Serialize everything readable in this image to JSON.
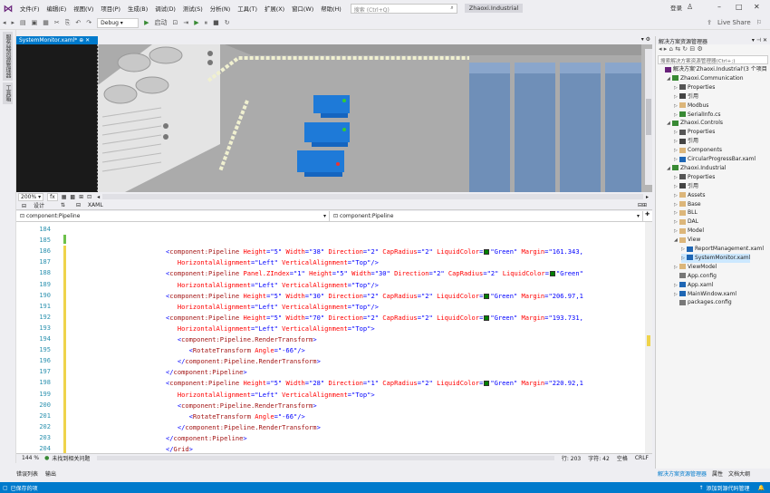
{
  "menubar": {
    "items": [
      "文件(F)",
      "编辑(E)",
      "视图(V)",
      "项目(P)",
      "生成(B)",
      "调试(D)",
      "测试(S)",
      "分析(N)",
      "工具(T)",
      "扩展(X)",
      "窗口(W)",
      "帮助(H)"
    ],
    "search_placeholder": "搜索 (Ctrl+Q)",
    "solution_name": "Zhaoxi.Industrial",
    "login": "登录",
    "live_share": "Live Share"
  },
  "toolbar": {
    "config": "Debug",
    "start_label": "启动"
  },
  "left_strip": [
    "服务器资源管理器",
    "工具箱"
  ],
  "doc_tab": {
    "label": "SystemMonitor.xaml*"
  },
  "designer_bar": {
    "zoom": "200%",
    "fx": "fx"
  },
  "split_bar": {
    "design": "设计",
    "swap": "⇅",
    "xaml": "XAML"
  },
  "nav_bar": {
    "left": "component:Pipeline",
    "right": "component:Pipeline"
  },
  "colors": {
    "accent": "#007acc",
    "tag": "#a31515",
    "attr": "#ff0000",
    "value": "#0000ff",
    "linenum": "#2b91af",
    "green": "#008000"
  },
  "code": [
    {
      "n": "184",
      "html": ""
    },
    {
      "n": "185",
      "html": ""
    },
    {
      "n": "186",
      "html": "<span class=\"br\">&lt;</span><span class=\"tagc\">component:Pipeline</span> <span class=\"attr\">Height</span><span class=\"br\">=</span><span class=\"val\">\"5\"</span> <span class=\"attr\">Width</span><span class=\"br\">=</span><span class=\"val\">\"38\"</span> <span class=\"attr\">Direction</span><span class=\"br\">=</span><span class=\"val\">\"2\"</span> <span class=\"attr\">CapRadius</span><span class=\"br\">=</span><span class=\"val\">\"2\"</span> <span class=\"attr\">LiquidColor</span><span class=\"br\">=</span><span class=\"sw\" style=\"background:#008000\"></span><span class=\"val\">\"Green\"</span> <span class=\"attr\">Margin</span><span class=\"br\">=</span><span class=\"val\">\"161.343,</span>"
    },
    {
      "n": "187",
      "html": "&nbsp;&nbsp;&nbsp;<span class=\"attr\">HorizontalAlignment</span><span class=\"br\">=</span><span class=\"val\">\"Left\"</span> <span class=\"attr\">VerticalAlignment</span><span class=\"br\">=</span><span class=\"val\">\"Top\"</span><span class=\"br\">/&gt;</span>"
    },
    {
      "n": "188",
      "html": "<span class=\"br\">&lt;</span><span class=\"tagc\">component:Pipeline</span> <span class=\"attr\">Panel.ZIndex</span><span class=\"br\">=</span><span class=\"val\">\"1\"</span> <span class=\"attr\">Height</span><span class=\"br\">=</span><span class=\"val\">\"5\"</span> <span class=\"attr\">Width</span><span class=\"br\">=</span><span class=\"val\">\"30\"</span> <span class=\"attr\">Direction</span><span class=\"br\">=</span><span class=\"val\">\"2\"</span> <span class=\"attr\">CapRadius</span><span class=\"br\">=</span><span class=\"val\">\"2\"</span> <span class=\"attr\">LiquidColor</span><span class=\"br\">=</span><span class=\"sw\" style=\"background:#008000\"></span><span class=\"val\">\"Green\"</span>"
    },
    {
      "n": "189",
      "html": "&nbsp;&nbsp;&nbsp;<span class=\"attr\">HorizontalAlignment</span><span class=\"br\">=</span><span class=\"val\">\"Left\"</span> <span class=\"attr\">VerticalAlignment</span><span class=\"br\">=</span><span class=\"val\">\"Top\"</span><span class=\"br\">/&gt;</span>"
    },
    {
      "n": "190",
      "html": "<span class=\"br\">&lt;</span><span class=\"tagc\">component:Pipeline</span> <span class=\"attr\">Height</span><span class=\"br\">=</span><span class=\"val\">\"5\"</span> <span class=\"attr\">Width</span><span class=\"br\">=</span><span class=\"val\">\"30\"</span> <span class=\"attr\">Direction</span><span class=\"br\">=</span><span class=\"val\">\"2\"</span> <span class=\"attr\">CapRadius</span><span class=\"br\">=</span><span class=\"val\">\"2\"</span> <span class=\"attr\">LiquidColor</span><span class=\"br\">=</span><span class=\"sw\" style=\"background:#008000\"></span><span class=\"val\">\"Green\"</span> <span class=\"attr\">Margin</span><span class=\"br\">=</span><span class=\"val\">\"206.97,1</span>"
    },
    {
      "n": "191",
      "html": "&nbsp;&nbsp;&nbsp;<span class=\"attr\">HorizontalAlignment</span><span class=\"br\">=</span><span class=\"val\">\"Left\"</span> <span class=\"attr\">VerticalAlignment</span><span class=\"br\">=</span><span class=\"val\">\"Top\"</span><span class=\"br\">/&gt;</span>"
    },
    {
      "n": "192",
      "html": "<span class=\"br\">&lt;</span><span class=\"tagc\">component:Pipeline</span> <span class=\"attr\">Height</span><span class=\"br\">=</span><span class=\"val\">\"5\"</span> <span class=\"attr\">Width</span><span class=\"br\">=</span><span class=\"val\">\"70\"</span> <span class=\"attr\">Direction</span><span class=\"br\">=</span><span class=\"val\">\"2\"</span> <span class=\"attr\">CapRadius</span><span class=\"br\">=</span><span class=\"val\">\"2\"</span> <span class=\"attr\">LiquidColor</span><span class=\"br\">=</span><span class=\"sw\" style=\"background:#008000\"></span><span class=\"val\">\"Green\"</span> <span class=\"attr\">Margin</span><span class=\"br\">=</span><span class=\"val\">\"193.731,</span>"
    },
    {
      "n": "193",
      "html": "&nbsp;&nbsp;&nbsp;<span class=\"attr\">HorizontalAlignment</span><span class=\"br\">=</span><span class=\"val\">\"Left\"</span> <span class=\"attr\">VerticalAlignment</span><span class=\"br\">=</span><span class=\"val\">\"Top\"</span><span class=\"br\">&gt;</span>"
    },
    {
      "n": "194",
      "html": "&nbsp;&nbsp;&nbsp;<span class=\"br\">&lt;</span><span class=\"tagc\">component:Pipeline.RenderTransform</span><span class=\"br\">&gt;</span>"
    },
    {
      "n": "195",
      "html": "&nbsp;&nbsp;&nbsp;&nbsp;&nbsp;&nbsp;<span class=\"br\">&lt;</span><span class=\"tagc\">RotateTransform</span> <span class=\"attr\">Angle</span><span class=\"br\">=</span><span class=\"val\">\"-66\"</span><span class=\"br\">/&gt;</span>"
    },
    {
      "n": "196",
      "html": "&nbsp;&nbsp;&nbsp;<span class=\"br\">&lt;/</span><span class=\"tagc\">component:Pipeline.RenderTransform</span><span class=\"br\">&gt;</span>"
    },
    {
      "n": "197",
      "html": "<span class=\"br\">&lt;/</span><span class=\"tagc\">component:Pipeline</span><span class=\"br\">&gt;</span>"
    },
    {
      "n": "198",
      "html": "<span class=\"br\">&lt;</span><span class=\"tagc\">component:Pipeline</span> <span class=\"attr\">Height</span><span class=\"br\">=</span><span class=\"val\">\"5\"</span> <span class=\"attr\">Width</span><span class=\"br\">=</span><span class=\"val\">\"28\"</span> <span class=\"attr\">Direction</span><span class=\"br\">=</span><span class=\"val\">\"1\"</span> <span class=\"attr\">CapRadius</span><span class=\"br\">=</span><span class=\"val\">\"2\"</span> <span class=\"attr\">LiquidColor</span><span class=\"br\">=</span><span class=\"sw\" style=\"background:#008000\"></span><span class=\"val\">\"Green\"</span> <span class=\"attr\">Margin</span><span class=\"br\">=</span><span class=\"val\">\"220.92,1</span>"
    },
    {
      "n": "199",
      "html": "&nbsp;&nbsp;&nbsp;<span class=\"attr\">HorizontalAlignment</span><span class=\"br\">=</span><span class=\"val\">\"Left\"</span> <span class=\"attr\">VerticalAlignment</span><span class=\"br\">=</span><span class=\"val\">\"Top\"</span><span class=\"br\">&gt;</span>"
    },
    {
      "n": "200",
      "html": "&nbsp;&nbsp;&nbsp;<span class=\"br\">&lt;</span><span class=\"tagc\">component:Pipeline.RenderTransform</span><span class=\"br\">&gt;</span>"
    },
    {
      "n": "201",
      "html": "&nbsp;&nbsp;&nbsp;&nbsp;&nbsp;&nbsp;<span class=\"br\">&lt;</span><span class=\"tagc\">RotateTransform</span> <span class=\"attr\">Angle</span><span class=\"br\">=</span><span class=\"val\">\"-66\"</span><span class=\"br\">/&gt;</span>"
    },
    {
      "n": "202",
      "html": "&nbsp;&nbsp;&nbsp;<span class=\"br\">&lt;/</span><span class=\"tagc\">component:Pipeline.RenderTransform</span><span class=\"br\">&gt;</span>"
    },
    {
      "n": "203",
      "html": "<span class=\"br\">&lt;/</span><span class=\"tagc\">component:Pipeline</span><span class=\"br\">&gt;</span>"
    },
    {
      "n": "204",
      "html": "<span class=\"br\">&lt;/</span><span class=\"tagc\">Grid</span><span class=\"br\">&gt;</span>"
    }
  ],
  "status": {
    "zoom": "144 %",
    "issues": "未找到相关问题",
    "line": "行: 203",
    "col": "字符: 42",
    "mode1": "空格",
    "mode2": "CRLF"
  },
  "bottom_tabs": [
    "错误列表",
    "输出"
  ],
  "vs_status": {
    "left": "已保存的项",
    "right": "添加到源代码管理"
  },
  "solution_explorer": {
    "title": "解决方案资源管理器",
    "search": "搜索解决方案资源管理器(Ctrl+;)",
    "items": [
      {
        "label": "解决方案'Zhaoxi.Industrial'(3 个项目",
        "icon": "solution-icon"
      },
      {
        "label": "Zhaoxi.Communication",
        "icon": "csproj-icon"
      },
      {
        "label": "Properties",
        "icon": "wrench-icon"
      },
      {
        "label": "引用",
        "icon": "ref-icon"
      },
      {
        "label": "Modbus",
        "icon": "folder-icon"
      },
      {
        "label": "SerialInfo.cs",
        "icon": "cs-icon"
      },
      {
        "label": "Zhaoxi.Controls",
        "icon": "csproj-icon"
      },
      {
        "label": "Properties",
        "icon": "wrench-icon"
      },
      {
        "label": "引用",
        "icon": "ref-icon"
      },
      {
        "label": "Components",
        "icon": "folder-icon"
      },
      {
        "label": "CircularProgressBar.xaml",
        "icon": "xaml-icon"
      },
      {
        "label": "Zhaoxi.Industrial",
        "icon": "csproj-icon"
      },
      {
        "label": "Properties",
        "icon": "wrench-icon"
      },
      {
        "label": "引用",
        "icon": "ref-icon"
      },
      {
        "label": "Assets",
        "icon": "folder-icon"
      },
      {
        "label": "Base",
        "icon": "folder-icon"
      },
      {
        "label": "BLL",
        "icon": "folder-icon"
      },
      {
        "label": "DAL",
        "icon": "folder-icon"
      },
      {
        "label": "Model",
        "icon": "folder-icon"
      },
      {
        "label": "View",
        "icon": "folder-icon"
      },
      {
        "label": "ReportManagement.xaml",
        "icon": "xaml-icon"
      },
      {
        "label": "SystemMonitor.xaml",
        "icon": "xaml-icon"
      },
      {
        "label": "ViewModel",
        "icon": "folder-icon"
      },
      {
        "label": "App.config",
        "icon": "config-icon"
      },
      {
        "label": "App.xaml",
        "icon": "xaml-icon"
      },
      {
        "label": "MainWindow.xaml",
        "icon": "xaml-icon"
      },
      {
        "label": "packages.config",
        "icon": "config-icon"
      }
    ],
    "bottom_tabs": [
      "解决方案资源管理器",
      "属性",
      "文档大纲"
    ]
  }
}
